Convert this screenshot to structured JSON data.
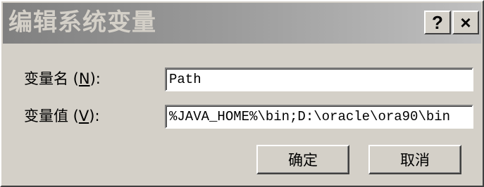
{
  "window": {
    "title": "编辑系统变量",
    "help_label": "?",
    "close_label": "×"
  },
  "fields": {
    "name": {
      "label_prefix": "变量名 (",
      "label_hotkey": "N",
      "label_suffix": "):",
      "value": "Path"
    },
    "value": {
      "label_prefix": "变量值 (",
      "label_hotkey": "V",
      "label_suffix": "):",
      "value": "%JAVA_HOME%\\bin;D:\\oracle\\ora90\\bin"
    }
  },
  "buttons": {
    "ok_label": "确定",
    "cancel_label": "取消"
  }
}
